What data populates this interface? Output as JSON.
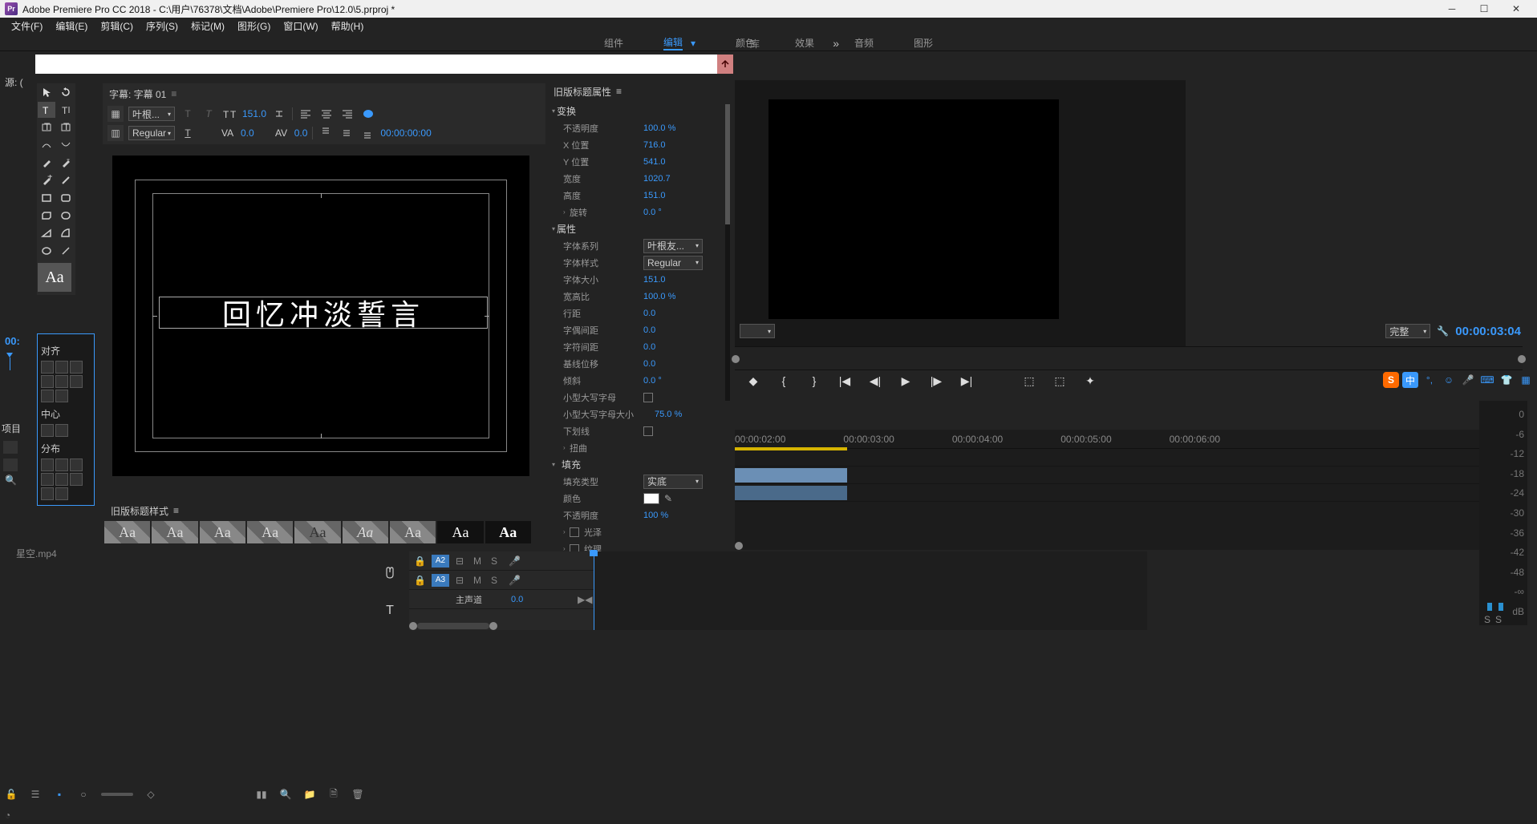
{
  "app": {
    "title": "Adobe Premiere Pro CC 2018 - C:\\用户\\76378\\文档\\Adobe\\Premiere Pro\\12.0\\5.prproj *"
  },
  "menu": {
    "file": "文件(F)",
    "edit": "编辑(E)",
    "clip": "剪辑(C)",
    "sequence": "序列(S)",
    "marker": "标记(M)",
    "graphic": "图形(G)",
    "window": "窗口(W)",
    "help": "帮助(H)"
  },
  "workspace": {
    "assembly": "组件",
    "editing": "编辑",
    "color": "颜色",
    "effects": "效果",
    "audio": "音频",
    "graphics": "图形",
    "library": "库"
  },
  "source": {
    "label": "源: ("
  },
  "titler": {
    "tab_label": "字幕: 字幕 01",
    "font_family": "叶根...",
    "font_style": "Regular",
    "size": "151.0",
    "kerning": "0.0",
    "leading": "0.0",
    "timecode": "00:00:00:00",
    "title_text": "回忆冲淡誓言"
  },
  "align": {
    "align": "对齐",
    "center": "中心",
    "distribute": "分布"
  },
  "props": {
    "header": "旧版标题属性",
    "transform": "变换",
    "opacity_l": "不透明度",
    "opacity_v": "100.0 %",
    "xpos_l": "X 位置",
    "xpos_v": "716.0",
    "ypos_l": "Y 位置",
    "ypos_v": "541.0",
    "width_l": "宽度",
    "width_v": "1020.7",
    "height_l": "高度",
    "height_v": "151.0",
    "rotate_l": "旋转",
    "rotate_v": "0.0 °",
    "attrs": "属性",
    "ffam_l": "字体系列",
    "ffam_v": "叶根友...",
    "fsty_l": "字体样式",
    "fsty_v": "Regular",
    "fsize_l": "字体大小",
    "fsize_v": "151.0",
    "aspect_l": "宽高比",
    "aspect_v": "100.0 %",
    "lead_l": "行距",
    "lead_v": "0.0",
    "kern_l": "字偶间距",
    "kern_v": "0.0",
    "track_l": "字符间距",
    "track_v": "0.0",
    "base_l": "基线位移",
    "base_v": "0.0",
    "slant_l": "倾斜",
    "slant_v": "0.0 °",
    "scaps_l": "小型大写字母",
    "scapsize_l": "小型大写字母大小",
    "scapsize_v": "75.0 %",
    "under_l": "下划线",
    "distort": "扭曲",
    "fill": "填充",
    "filltype_l": "填充类型",
    "filltype_v": "实底",
    "color_l": "颜色",
    "fillop_l": "不透明度",
    "fillop_v": "100 %",
    "sheen_l": "光泽",
    "texture_l": "纹理"
  },
  "styles": {
    "header": "旧版标题样式",
    "aa": "Aa"
  },
  "project": {
    "tab": "项目",
    "tc": "00:",
    "file": "星空.mp4"
  },
  "timeline": {
    "a2": "A2",
    "a3": "A3",
    "m": "M",
    "s": "S",
    "master": "主声道",
    "master_val": "0.0"
  },
  "program": {
    "fit": "完整",
    "tc": "00:00:03:04"
  },
  "ruler": {
    "t1": "00:00:02:00",
    "t2": "00:00:03:00",
    "t3": "00:00:04:00",
    "t4": "00:00:05:00",
    "t5": "00:00:06:00"
  },
  "meters": {
    "db": [
      "0",
      "-6",
      "-12",
      "-18",
      "-24",
      "-30",
      "-36",
      "-42",
      "-48",
      "-∞",
      "dB"
    ],
    "s": "S"
  },
  "ime": {
    "zh": "中",
    "punct": "°,",
    "face": "☺"
  }
}
